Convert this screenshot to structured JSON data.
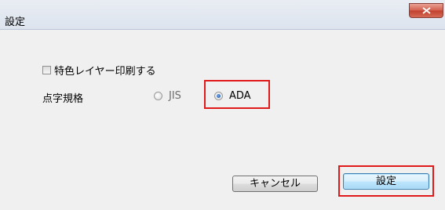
{
  "window": {
    "title": "設定",
    "close_icon": "close-icon"
  },
  "options": {
    "spot_color_checkbox_label": "特色レイヤー印刷する",
    "spot_color_checked": false,
    "braille_standard_label": "点字規格",
    "radio_options": [
      {
        "label": "JIS",
        "selected": false
      },
      {
        "label": "ADA",
        "selected": true
      }
    ]
  },
  "buttons": {
    "cancel_label": "キャンセル",
    "ok_label": "設定"
  },
  "colors": {
    "highlight": "#e01a1a",
    "close_button": "#c0402d",
    "primary_button_border": "#3c7fb1"
  }
}
